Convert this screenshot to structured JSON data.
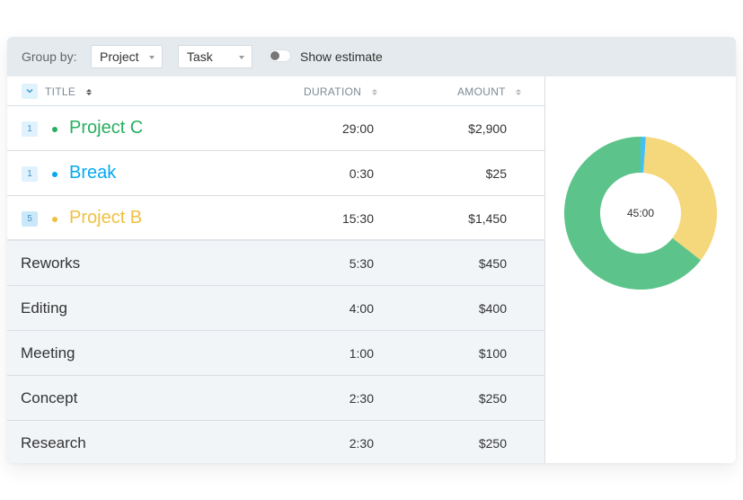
{
  "toolbar": {
    "group_by_label": "Group by:",
    "group_by_primary": "Project",
    "group_by_secondary": "Task",
    "show_estimate_label": "Show estimate",
    "show_estimate_on": false
  },
  "table": {
    "headers": {
      "title": "TITLE",
      "duration": "DURATION",
      "amount": "AMOUNT"
    },
    "groups": [
      {
        "count": "1",
        "name": "Project C",
        "duration": "29:00",
        "amount": "$2,900",
        "color": "#27ae60"
      },
      {
        "count": "1",
        "name": "Break",
        "duration": "0:30",
        "amount": "$25",
        "color": "#03a9f4"
      },
      {
        "count": "5",
        "name": "Project B",
        "duration": "15:30",
        "amount": "$1,450",
        "color": "#f0c040"
      }
    ],
    "subrows": [
      {
        "name": "Reworks",
        "duration": "5:30",
        "amount": "$450"
      },
      {
        "name": "Editing",
        "duration": "4:00",
        "amount": "$400"
      },
      {
        "name": "Meeting",
        "duration": "1:00",
        "amount": "$100"
      },
      {
        "name": "Concept",
        "duration": "2:30",
        "amount": "$250"
      },
      {
        "name": "Research",
        "duration": "2:30",
        "amount": "$250"
      }
    ]
  },
  "chart_data": {
    "type": "pie",
    "variant": "donut",
    "center_label": "45:00",
    "slices": [
      {
        "label": "Break",
        "value_minutes": 30,
        "color": "#42c1f7"
      },
      {
        "label": "Project B",
        "value_minutes": 930,
        "color": "#f5d77c"
      },
      {
        "label": "Project C",
        "value_minutes": 1740,
        "color": "#5cc48a"
      }
    ],
    "start": "top",
    "direction": "clockwise"
  }
}
